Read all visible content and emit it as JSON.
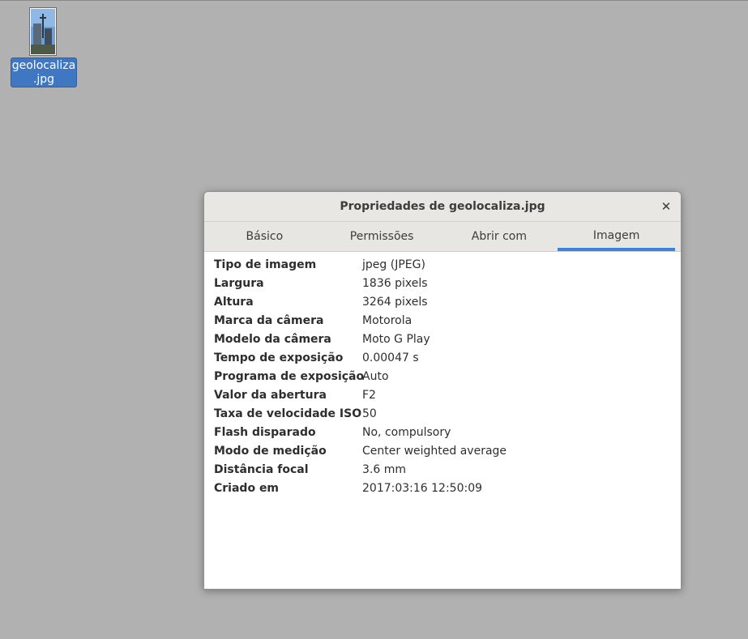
{
  "desktop": {
    "file_icon": {
      "name_line1": "geolocaliza",
      "name_line2": ".jpg",
      "icon": "image-thumbnail-icon"
    }
  },
  "dialog": {
    "title": "Propriedades de geolocaliza.jpg",
    "close_icon": "close-icon",
    "tabs": [
      {
        "label": "Básico"
      },
      {
        "label": "Permissões"
      },
      {
        "label": "Abrir com"
      },
      {
        "label": "Imagem",
        "active": true
      }
    ],
    "properties": [
      {
        "key": "Tipo de imagem",
        "value": "jpeg (JPEG)"
      },
      {
        "key": "Largura",
        "value": "1836 pixels"
      },
      {
        "key": "Altura",
        "value": "3264 pixels"
      },
      {
        "key": "Marca da câmera",
        "value": "Motorola"
      },
      {
        "key": "Modelo da câmera",
        "value": "Moto G Play"
      },
      {
        "key": "Tempo de exposição",
        "value": "0.00047 s"
      },
      {
        "key": "Programa de exposição",
        "value": "Auto"
      },
      {
        "key": "Valor da abertura",
        "value": "F2"
      },
      {
        "key": "Taxa de velocidade ISO",
        "value": "50"
      },
      {
        "key": "Flash disparado",
        "value": "No, compulsory"
      },
      {
        "key": "Modo de medição",
        "value": "Center weighted average"
      },
      {
        "key": "Distância focal",
        "value": "3.6 mm"
      },
      {
        "key": "Criado em",
        "value": "2017:03:16 12:50:09"
      }
    ]
  },
  "colors": {
    "desktop_bg": "#b1b1b1",
    "selection": "#3f77c3",
    "active_tab_indicator": "#3c83dc"
  }
}
